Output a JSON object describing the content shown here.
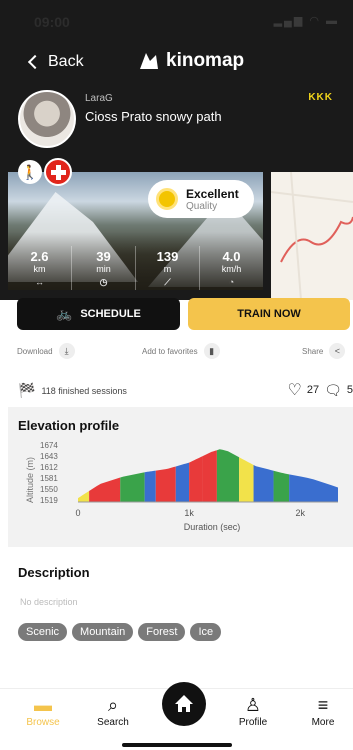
{
  "status": {
    "time": "09:00",
    "icons": "▂▄▆ ◠ ▬"
  },
  "header": {
    "back_label": "Back",
    "brand": "kinomap"
  },
  "route": {
    "user": "LaraG",
    "title": "Cioss Prato snowy path",
    "kkk": "KKK"
  },
  "quality": {
    "label": "Excellent",
    "sub": "Quality"
  },
  "stats": [
    {
      "value": "2.6",
      "unit": "km",
      "icon": "↔"
    },
    {
      "value": "39",
      "unit": "min",
      "icon": "◷"
    },
    {
      "value": "139",
      "unit": "m",
      "icon": "⟋"
    },
    {
      "value": "4.0",
      "unit": "km/h",
      "icon": "◔"
    }
  ],
  "buttons": {
    "schedule": "SCHEDULE",
    "train": "TRAIN NOW"
  },
  "actions": {
    "download": "Download",
    "favorites": "Add to favorites",
    "share": "Share"
  },
  "sessions": {
    "text": "118 finished sessions",
    "likes": "27",
    "comments": "5"
  },
  "elevation": {
    "title": "Elevation profile",
    "ylabel": "Altitude (m)",
    "xlabel": "Duration (sec)",
    "yticks": [
      "1674",
      "1643",
      "1612",
      "1581",
      "1550",
      "1519"
    ],
    "xticks": [
      "0",
      "1k",
      "2k"
    ]
  },
  "chart_data": {
    "type": "area",
    "xlabel": "Duration (sec)",
    "ylabel": "Altitude (m)",
    "ylim": [
      1519,
      1674
    ],
    "xlim": [
      0,
      2340
    ],
    "x": [
      0,
      100,
      200,
      400,
      600,
      800,
      1000,
      1100,
      1200,
      1280,
      1350,
      1450,
      1600,
      1850,
      2100,
      2340
    ],
    "y": [
      1530,
      1550,
      1570,
      1590,
      1603,
      1612,
      1630,
      1645,
      1660,
      1668,
      1662,
      1645,
      1620,
      1600,
      1585,
      1560
    ],
    "segments": [
      {
        "from": 0,
        "to": 100,
        "color": "#f2e24a"
      },
      {
        "from": 100,
        "to": 380,
        "color": "#e83a3a"
      },
      {
        "from": 380,
        "to": 600,
        "color": "#3aa34a"
      },
      {
        "from": 600,
        "to": 700,
        "color": "#3a6ecf"
      },
      {
        "from": 700,
        "to": 880,
        "color": "#e83a3a"
      },
      {
        "from": 880,
        "to": 1000,
        "color": "#3a6ecf"
      },
      {
        "from": 1000,
        "to": 1120,
        "color": "#e83a3a"
      },
      {
        "from": 1120,
        "to": 1250,
        "color": "#e83a3a"
      },
      {
        "from": 1250,
        "to": 1450,
        "color": "#3aa34a"
      },
      {
        "from": 1450,
        "to": 1580,
        "color": "#f2e24a"
      },
      {
        "from": 1580,
        "to": 1760,
        "color": "#3a6ecf"
      },
      {
        "from": 1760,
        "to": 1900,
        "color": "#3aa34a"
      },
      {
        "from": 1900,
        "to": 2340,
        "color": "#3a6ecf"
      }
    ],
    "grid": false
  },
  "description": {
    "title": "Description",
    "text": "No description"
  },
  "tags": [
    "Scenic",
    "Mountain",
    "Forest",
    "Ice"
  ],
  "nav": {
    "browse": "Browse",
    "search": "Search",
    "profile": "Profile",
    "more": "More"
  },
  "colors": {
    "accent": "#f4c44c",
    "dark": "#1a1a1a"
  }
}
